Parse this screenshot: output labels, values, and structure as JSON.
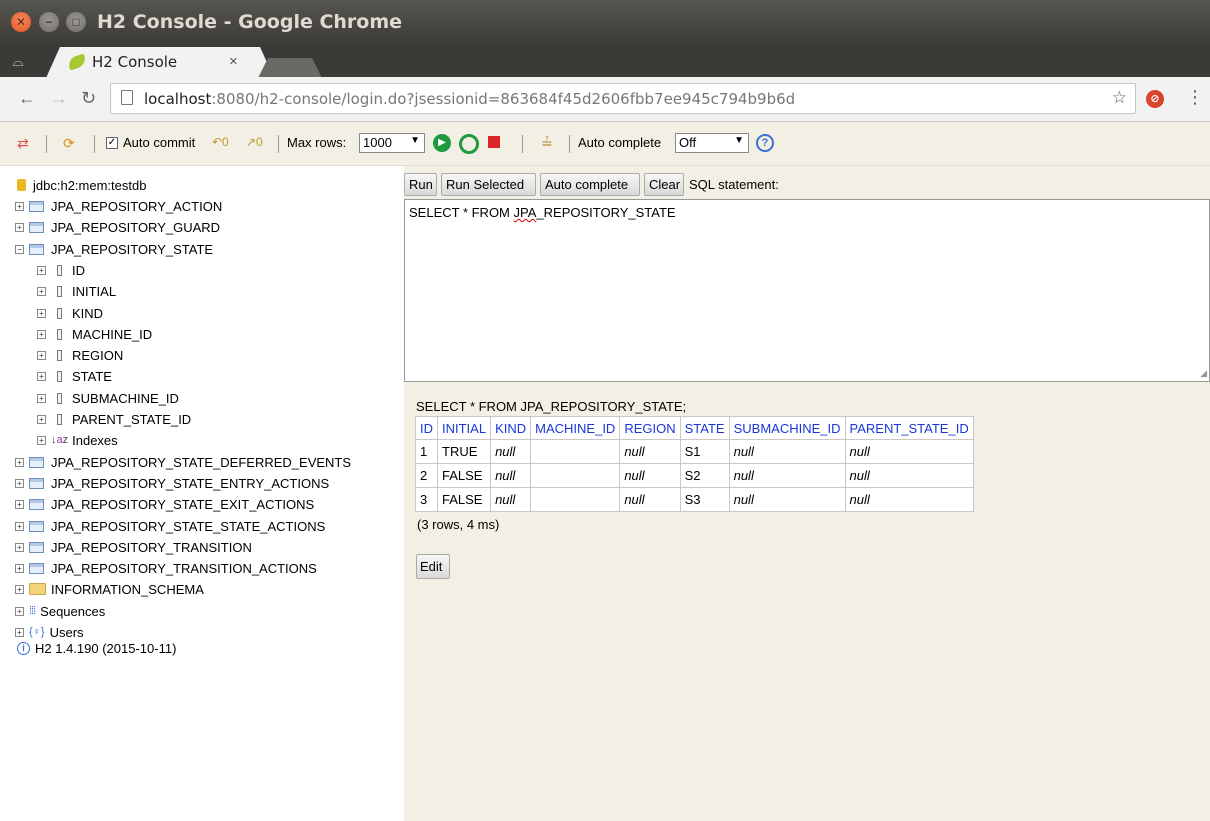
{
  "window": {
    "title": "H2 Console - Google Chrome",
    "close_glyph": "✕",
    "min_glyph": "−",
    "max_glyph": "□"
  },
  "tab": {
    "title": "H2 Console",
    "close_glyph": "×"
  },
  "address": {
    "host": "localhost",
    "path": ":8080/h2-console/login.do?jsessionid=863684f45d2606fbb7ee945c794b9b6d"
  },
  "toolbar": {
    "autocommit_label": "Auto commit",
    "maxrows_label": "Max rows:",
    "maxrows_value": "1000",
    "autocomplete_label": "Auto complete",
    "autocomplete_value": "Off",
    "help_glyph": "?"
  },
  "tree": {
    "connection": "jdbc:h2:mem:testdb",
    "items": [
      {
        "label": "JPA_REPOSITORY_ACTION",
        "kind": "table",
        "expander": "+"
      },
      {
        "label": "JPA_REPOSITORY_GUARD",
        "kind": "table",
        "expander": "+"
      },
      {
        "label": "JPA_REPOSITORY_STATE",
        "kind": "table",
        "expander": "−"
      },
      {
        "label": "ID",
        "kind": "column",
        "expander": "+"
      },
      {
        "label": "INITIAL",
        "kind": "column",
        "expander": "+"
      },
      {
        "label": "KIND",
        "kind": "column",
        "expander": "+"
      },
      {
        "label": "MACHINE_ID",
        "kind": "column",
        "expander": "+"
      },
      {
        "label": "REGION",
        "kind": "column",
        "expander": "+"
      },
      {
        "label": "STATE",
        "kind": "column",
        "expander": "+"
      },
      {
        "label": "SUBMACHINE_ID",
        "kind": "column",
        "expander": "+"
      },
      {
        "label": "PARENT_STATE_ID",
        "kind": "column",
        "expander": "+"
      },
      {
        "label": "Indexes",
        "kind": "indexes",
        "expander": "+"
      },
      {
        "label": "JPA_REPOSITORY_STATE_DEFERRED_EVENTS",
        "kind": "table",
        "expander": "+"
      },
      {
        "label": "JPA_REPOSITORY_STATE_ENTRY_ACTIONS",
        "kind": "table",
        "expander": "+"
      },
      {
        "label": "JPA_REPOSITORY_STATE_EXIT_ACTIONS",
        "kind": "table",
        "expander": "+"
      },
      {
        "label": "JPA_REPOSITORY_STATE_STATE_ACTIONS",
        "kind": "table",
        "expander": "+"
      },
      {
        "label": "JPA_REPOSITORY_TRANSITION",
        "kind": "table",
        "expander": "+"
      },
      {
        "label": "JPA_REPOSITORY_TRANSITION_ACTIONS",
        "kind": "table",
        "expander": "+"
      },
      {
        "label": "INFORMATION_SCHEMA",
        "kind": "folder",
        "expander": "+"
      },
      {
        "label": "Sequences",
        "kind": "sequences",
        "expander": "+"
      },
      {
        "label": "Users",
        "kind": "users",
        "expander": "+"
      }
    ],
    "version": "H2 1.4.190 (2015-10-11)"
  },
  "editor": {
    "run_label": "Run",
    "run_selected_label": "Run Selected",
    "auto_complete_label": "Auto complete",
    "clear_label": "Clear",
    "sql_label": "SQL statement:",
    "sql_prefix": "SELECT * FROM ",
    "sql_table": "JPA",
    "sql_suffix": "_REPOSITORY_STATE"
  },
  "result": {
    "query": "SELECT * FROM JPA_REPOSITORY_STATE;",
    "columns": [
      "ID",
      "INITIAL",
      "KIND",
      "MACHINE_ID",
      "REGION",
      "STATE",
      "SUBMACHINE_ID",
      "PARENT_STATE_ID"
    ],
    "rows": [
      [
        "1",
        "TRUE",
        "null",
        "",
        "null",
        "S1",
        "null",
        "null"
      ],
      [
        "2",
        "FALSE",
        "null",
        "",
        "null",
        "S2",
        "null",
        "null"
      ],
      [
        "3",
        "FALSE",
        "null",
        "",
        "null",
        "S3",
        "null",
        "null"
      ]
    ],
    "info": "(3 rows, 4 ms)",
    "edit_label": "Edit"
  }
}
